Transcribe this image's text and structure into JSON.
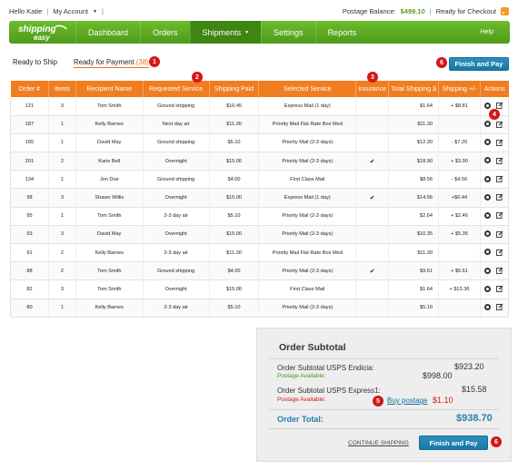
{
  "topbar": {
    "greeting": "Hello Katie",
    "my_account": "My Account",
    "postage_label": "Postage Balance:",
    "postage_value": "$499.10",
    "checkout": "Ready for Checkout"
  },
  "nav": {
    "logo_top": "shipping",
    "logo_bottom": "easy",
    "items": [
      "Dashboard",
      "Orders",
      "Shipments",
      "Settings",
      "Reports"
    ],
    "help": "Help"
  },
  "tabs": {
    "ready_to_ship": "Ready to Ship",
    "ready_for_payment": "Ready for Payment",
    "payment_count": "(38)"
  },
  "buttons": {
    "finish_and_pay": "Finish and Pay",
    "continue_shipping": "CONTINUE SHIPPING",
    "buy_postage": "Buy postage"
  },
  "callouts": {
    "one": "1",
    "two": "2",
    "three": "3",
    "four": "4",
    "five": "5",
    "six": "6"
  },
  "table": {
    "columns": [
      "Order #",
      "Items",
      "Recipient Name",
      "Requested Service",
      "Shipping Paid",
      "Selected Service",
      "Insurance",
      "Total Shipping $",
      "Shipping +/-",
      "Actions"
    ],
    "rows": [
      {
        "order": "121",
        "items": "3",
        "name": "Tom Smith",
        "requested": "Ground shipping",
        "paid": "$10.45",
        "selected": "Express Mail (1 day)",
        "insurance": "",
        "total": "$1.64",
        "diff": "+ $8.81"
      },
      {
        "order": "187",
        "items": "1",
        "name": "Kelly Barnes",
        "requested": "Next day air",
        "paid": "$11.30",
        "selected": "Priority Mail Flat Rate Box Med",
        "insurance": "",
        "total": "$11.30",
        "diff": ""
      },
      {
        "order": "165",
        "items": "1",
        "name": "David May",
        "requested": "Ground shipping",
        "paid": "$5.10",
        "selected": "Priority Mail (2-3 days)",
        "insurance": "",
        "total": "$12.30",
        "diff": "- $7.20"
      },
      {
        "order": "201",
        "items": "2",
        "name": "Karie Bell",
        "requested": "Overnight",
        "paid": "$15.00",
        "selected": "Priority Mail (2-3 days)",
        "insurance": "✔",
        "total": "$18.90",
        "diff": "+ $3.90"
      },
      {
        "order": "134",
        "items": "1",
        "name": "Jon Doe",
        "requested": "Ground shipping",
        "paid": "$4.00",
        "selected": "First Class Mail",
        "insurance": "",
        "total": "$8.56",
        "diff": "- $4.56"
      },
      {
        "order": "98",
        "items": "3",
        "name": "Shawn Willis",
        "requested": "Overnight",
        "paid": "$15.00",
        "selected": "Express Mail (1 day)",
        "insurance": "✔",
        "total": "$14.56",
        "diff": "+$0.44"
      },
      {
        "order": "95",
        "items": "1",
        "name": "Tom Smith",
        "requested": "2-3 day air",
        "paid": "$5.10",
        "selected": "Priority Mail (2-3 days)",
        "insurance": "",
        "total": "$2.64",
        "diff": "+ $2.46"
      },
      {
        "order": "93",
        "items": "3",
        "name": "David May",
        "requested": "Overnight",
        "paid": "$15.00",
        "selected": "Priority Mail (2-3 days)",
        "insurance": "",
        "total": "$10.35",
        "diff": "+ $5.35"
      },
      {
        "order": "91",
        "items": "2",
        "name": "Kelly Barnes",
        "requested": "2-3 day air",
        "paid": "$11.30",
        "selected": "Priority Mail Flat Rate Box Med",
        "insurance": "",
        "total": "$11.30",
        "diff": ""
      },
      {
        "order": "88",
        "items": "2",
        "name": "Tom Smith",
        "requested": "Ground shipping",
        "paid": "$4.00",
        "selected": "Priority Mail (2-3 days)",
        "insurance": "✔",
        "total": "$9.61",
        "diff": "+ $5.61"
      },
      {
        "order": "82",
        "items": "3",
        "name": "Tom Smith",
        "requested": "Overnight",
        "paid": "$15.00",
        "selected": "First Class Mail",
        "insurance": "",
        "total": "$1.64",
        "diff": "+ $13.36"
      },
      {
        "order": "80",
        "items": "1",
        "name": "Kelly Barnes",
        "requested": "2-3 day air",
        "paid": "$5.10",
        "selected": "Priority Mail (2-3 days)",
        "insurance": "",
        "total": "$5.10",
        "diff": ""
      }
    ]
  },
  "subtotal": {
    "title": "Order Subtotal",
    "endicia_label": "Order Subtotal USPS Endicia:",
    "endicia_note": "Postage Available:",
    "endicia_value": "$923.20",
    "endicia_available": "$998.00",
    "express_label": "Order Subtotal USPS Express1:",
    "express_note": "Postage Available:",
    "express_value": "$15.58",
    "express_available": "$1.10",
    "total_label": "Order Total:",
    "total_value": "$938.70"
  },
  "colors": {
    "nav_green": "#5aaa22",
    "header_orange": "#f07d1f",
    "primary_blue": "#1878a6",
    "callout_red": "#d4161a"
  }
}
